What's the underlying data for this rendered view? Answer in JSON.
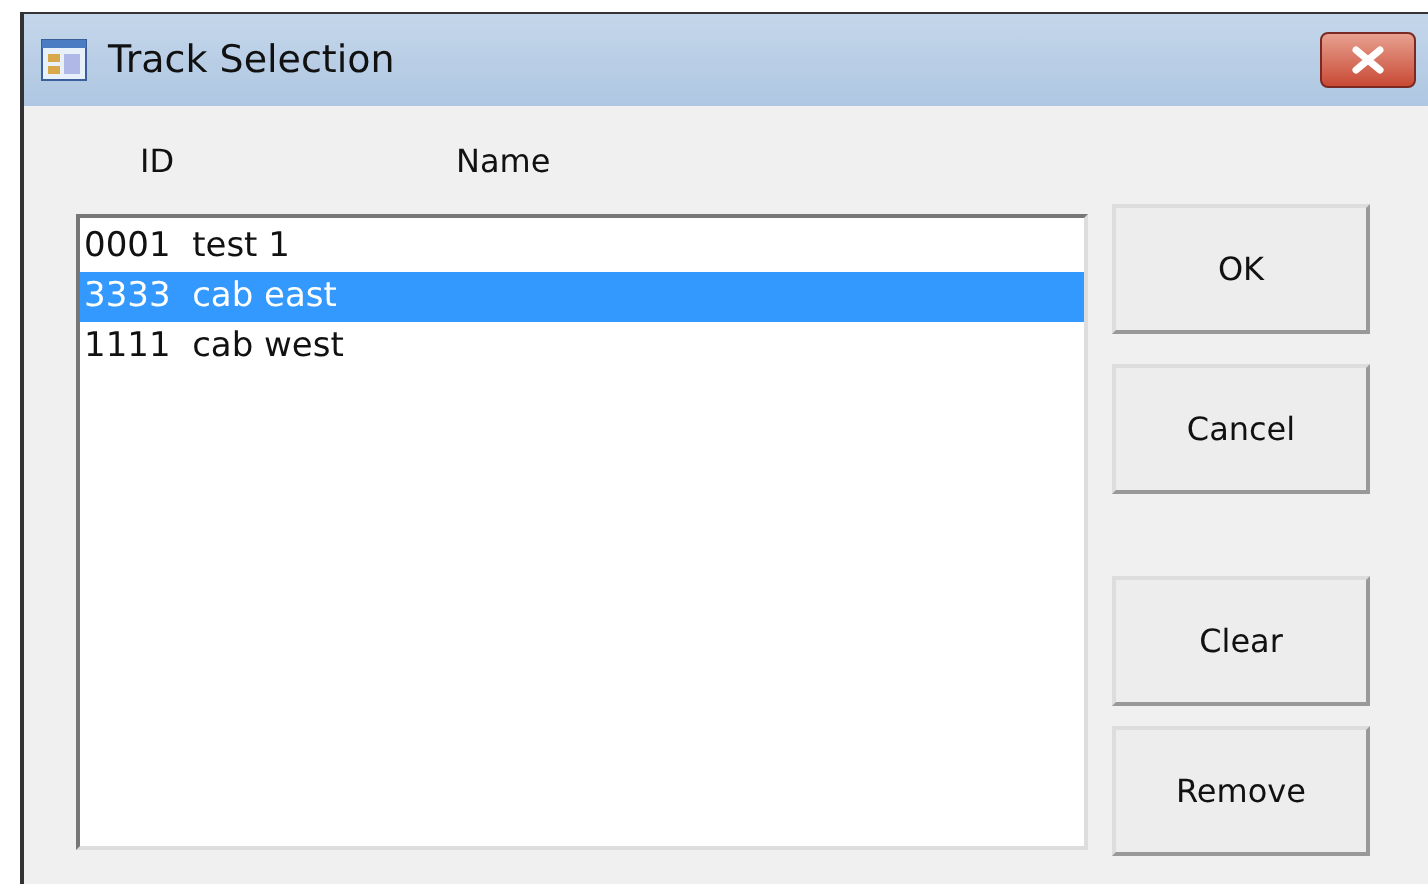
{
  "window": {
    "title": "Track Selection"
  },
  "columns": [
    "ID",
    "Name"
  ],
  "rows": [
    {
      "id": "0001",
      "name": "test 1",
      "selected": false
    },
    {
      "id": "3333",
      "name": "cab east",
      "selected": true
    },
    {
      "id": "1111",
      "name": "cab west",
      "selected": false
    }
  ],
  "button_groups": [
    {
      "buttons": [
        "OK",
        "Cancel"
      ]
    },
    {
      "buttons": [
        "Clear",
        "Remove"
      ]
    }
  ]
}
